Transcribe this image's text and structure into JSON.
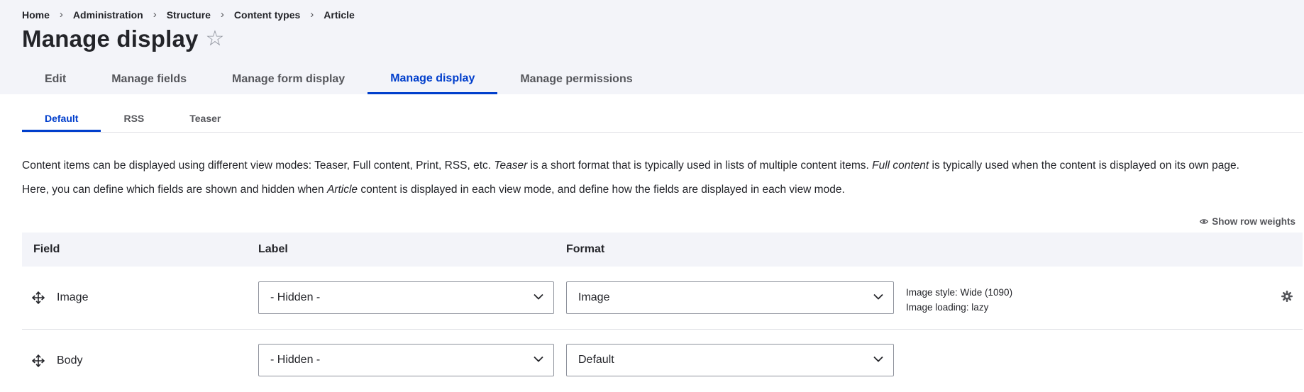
{
  "breadcrumb": {
    "items": [
      "Home",
      "Administration",
      "Structure",
      "Content types",
      "Article"
    ],
    "separator": "›"
  },
  "page": {
    "title": "Manage display",
    "star": "☆"
  },
  "primary_tabs": [
    "Edit",
    "Manage fields",
    "Manage form display",
    "Manage display",
    "Manage permissions"
  ],
  "secondary_tabs": [
    "Default",
    "RSS",
    "Teaser"
  ],
  "description": {
    "line1_a": "Content items can be displayed using different view modes: Teaser, Full content, Print, RSS, etc. ",
    "line1_em1": "Teaser",
    "line1_b": " is a short format that is typically used in lists of multiple content items. ",
    "line1_em2": "Full content",
    "line1_c": " is typically used when the content is displayed on its own page.",
    "line2_a": "Here, you can define which fields are shown and hidden when ",
    "line2_em": "Article",
    "line2_b": " content is displayed in each view mode, and define how the fields are displayed in each view mode."
  },
  "row_weights_label": "Show row weights",
  "table": {
    "headers": {
      "field": "Field",
      "label": "Label",
      "format": "Format"
    },
    "rows": [
      {
        "field": "Image",
        "label": "- Hidden -",
        "format": "Image",
        "summary": [
          "Image style: Wide (1090)",
          "Image loading: lazy"
        ]
      },
      {
        "field": "Body",
        "label": "- Hidden -",
        "format": "Default"
      }
    ]
  },
  "colors": {
    "accent": "#003ecc",
    "header_bg": "#f3f4f9",
    "text": "#232429",
    "muted": "#55565b"
  },
  "icons": {
    "drag": "move-arrows-icon",
    "gear": "gear-icon",
    "eye": "eye-icon",
    "chevron": "chevron-down-icon",
    "star": "star-icon"
  }
}
